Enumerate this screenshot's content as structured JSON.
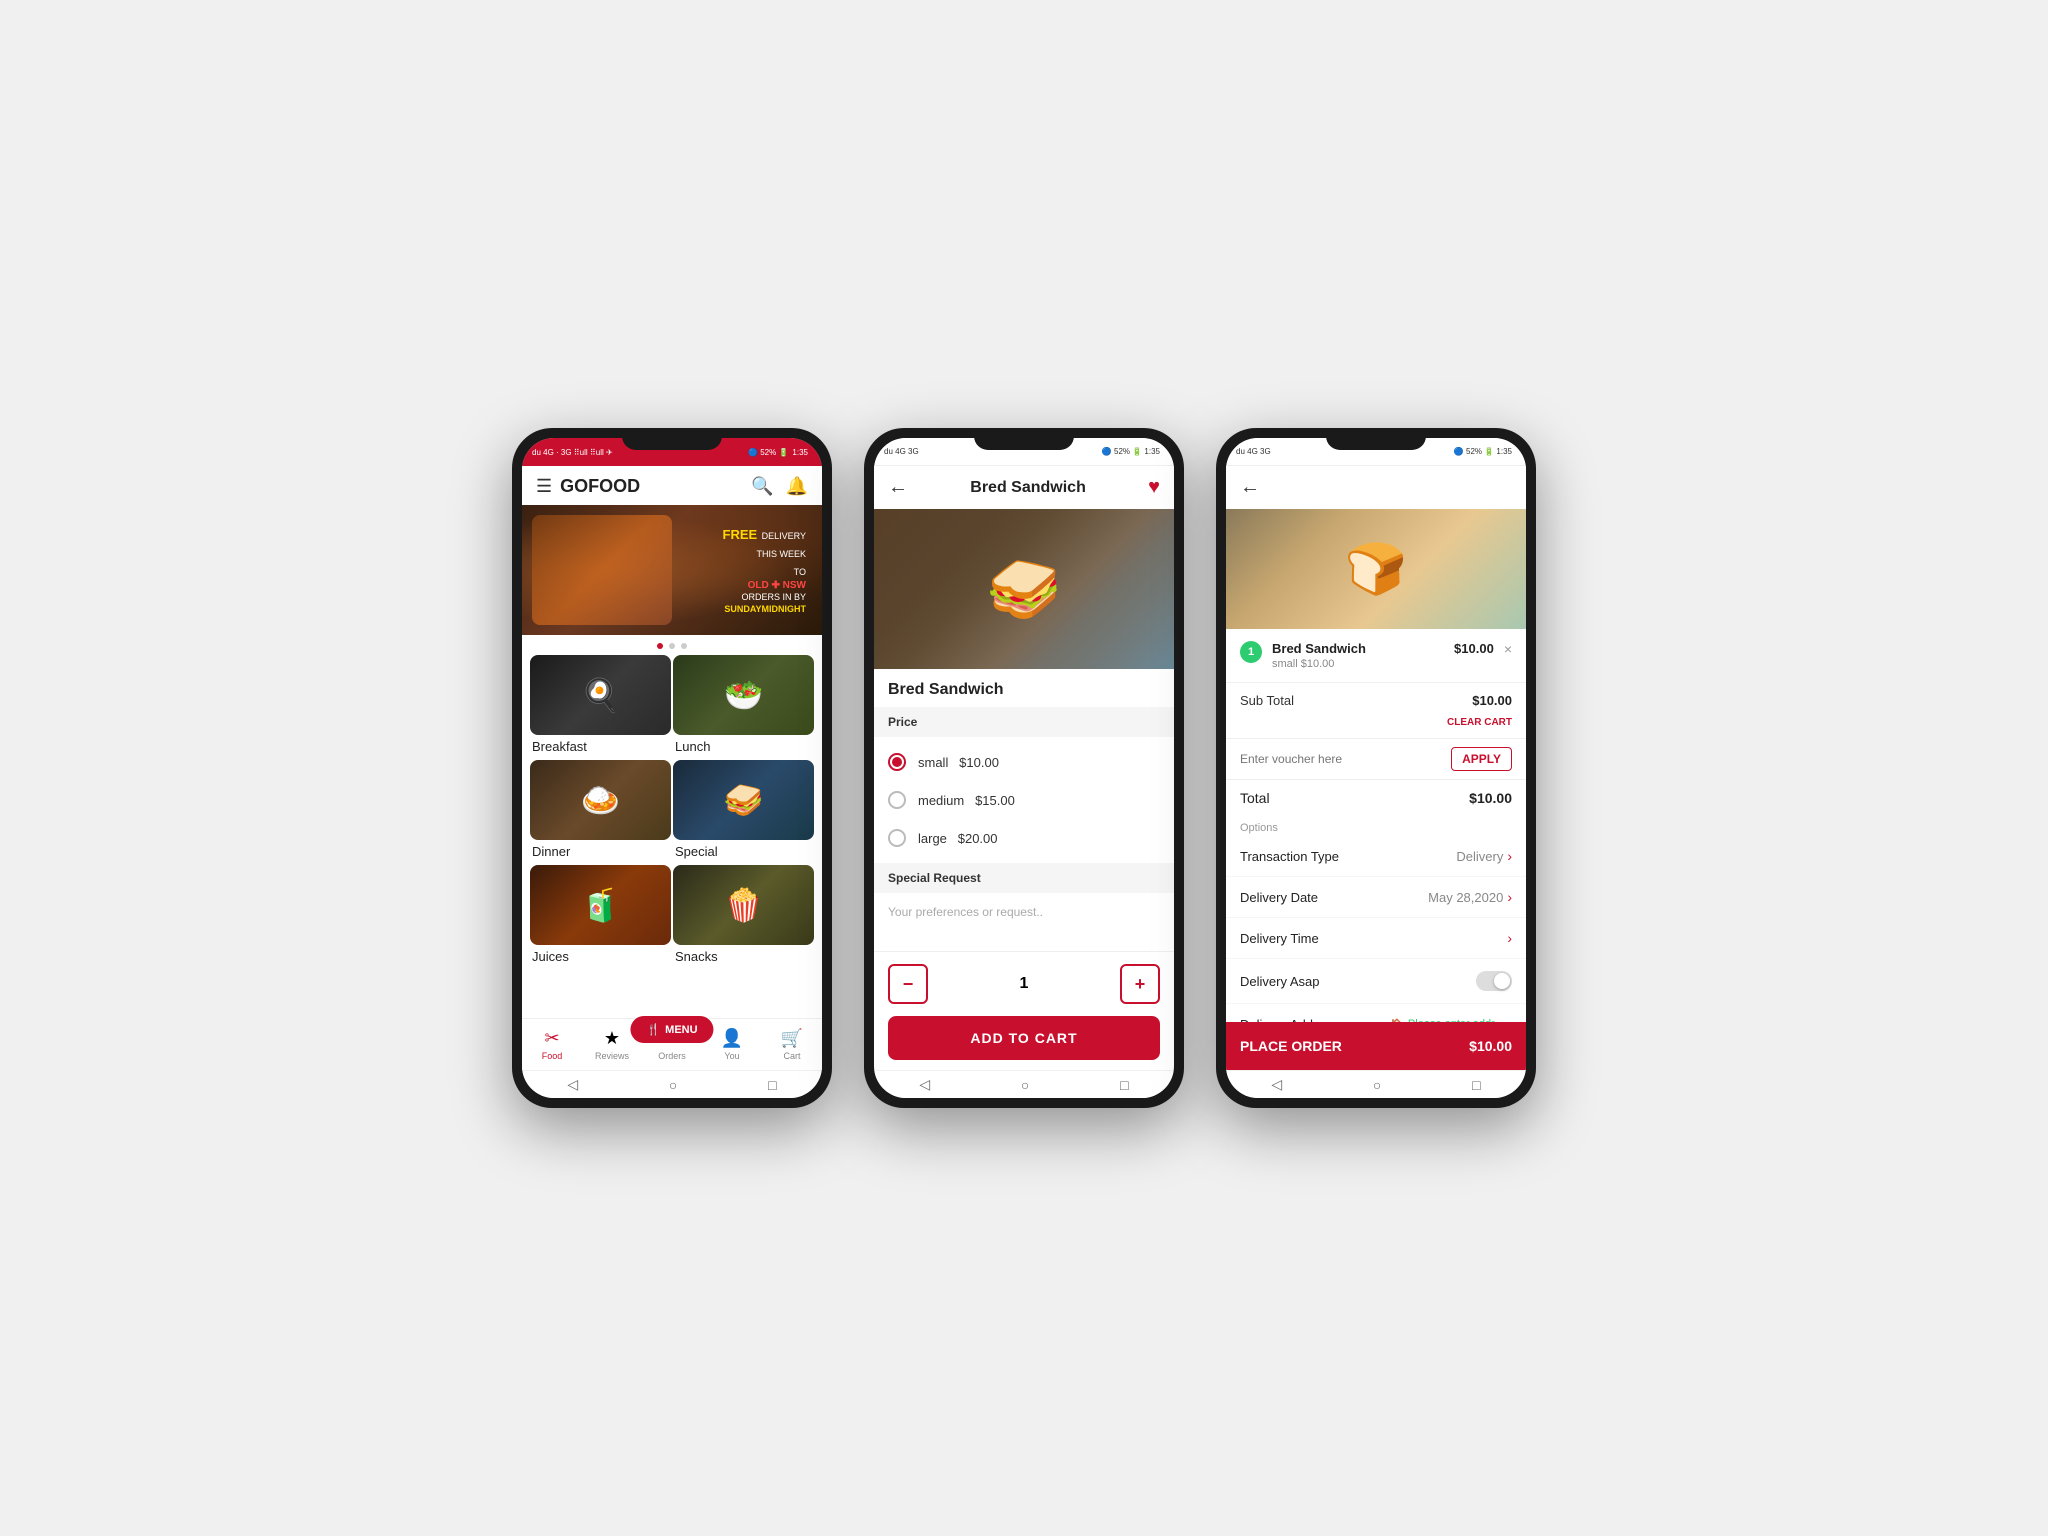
{
  "app": {
    "title": "GOFOOD",
    "status_left": "du 4G · 3G ⠿ull ⠿ull ✈",
    "status_right": "🔵 52% 🔋 1:35",
    "time": "1:35",
    "battery": "52%"
  },
  "phone1": {
    "header": {
      "menu_icon": "☰",
      "logo": "GOFOOD",
      "search_icon": "🔍",
      "bell_icon": "🔔"
    },
    "banner": {
      "free": "FREE",
      "line1": "DELIVERY",
      "line2": "THIS WEEK",
      "line3": "TO",
      "highlight": "OLD ✚ NSW",
      "line4": "ORDERS IN BY",
      "midnight": "SUNDAYMIDNIGHT"
    },
    "categories": [
      {
        "id": "breakfast",
        "label": "Breakfast",
        "emoji": "🍳"
      },
      {
        "id": "lunch",
        "label": "Lunch",
        "emoji": "🥗"
      },
      {
        "id": "dinner",
        "label": "Dinner",
        "emoji": "🍛"
      },
      {
        "id": "special",
        "label": "Special",
        "emoji": "🥪"
      },
      {
        "id": "juices",
        "label": "Juices",
        "emoji": "🧃"
      },
      {
        "id": "snacks",
        "label": "Snacks",
        "emoji": "🍿"
      }
    ],
    "menu_fab": "🍴 MENU",
    "nav": [
      {
        "id": "food",
        "label": "Food",
        "icon": "✂",
        "active": true
      },
      {
        "id": "reviews",
        "label": "Reviews",
        "icon": "★",
        "active": false
      },
      {
        "id": "orders",
        "label": "Orders",
        "icon": "≡",
        "active": false
      },
      {
        "id": "you",
        "label": "You",
        "icon": "👤",
        "active": false
      },
      {
        "id": "cart",
        "label": "Cart",
        "icon": "🛒",
        "active": false
      }
    ]
  },
  "phone2": {
    "header": {
      "back": "←",
      "title": "Bred Sandwich",
      "heart": "♥"
    },
    "item_name": "Bred Sandwich",
    "price_label": "Price",
    "options": [
      {
        "id": "small",
        "label": "small",
        "price": "$10.00",
        "selected": true
      },
      {
        "id": "medium",
        "label": "medium",
        "price": "$15.00",
        "selected": false
      },
      {
        "id": "large",
        "label": "large",
        "price": "$20.00",
        "selected": false
      }
    ],
    "special_request_label": "Special Request",
    "special_request_placeholder": "Your preferences or request..",
    "quantity": 1,
    "qty_minus": "−",
    "qty_plus": "+",
    "add_to_cart": "ADD TO CART"
  },
  "phone3": {
    "header": {
      "back": "←"
    },
    "cart": {
      "badge": "1",
      "item_name": "Bred Sandwich",
      "item_size": "small $10.00",
      "item_price": "$10.00",
      "close": "×"
    },
    "clear_cart": "CLEAR CART",
    "sub_total_label": "Sub Total",
    "sub_total_val": "$10.00",
    "voucher_placeholder": "Enter voucher here",
    "apply_btn": "APPLY",
    "total_label": "Total",
    "total_val": "$10.00",
    "options_label": "Options",
    "options": [
      {
        "label": "Transaction Type",
        "value": "Delivery",
        "type": "chevron"
      },
      {
        "label": "Delivery Date",
        "value": "May 28,2020",
        "type": "chevron"
      },
      {
        "label": "Delivery Time",
        "value": "",
        "type": "chevron"
      },
      {
        "label": "Delivery Asap",
        "value": "",
        "type": "toggle"
      },
      {
        "label": "Delivery Address",
        "value": "Please enter addr...",
        "type": "address"
      }
    ],
    "place_order": "PLACE ORDER",
    "place_order_price": "$10.00"
  }
}
